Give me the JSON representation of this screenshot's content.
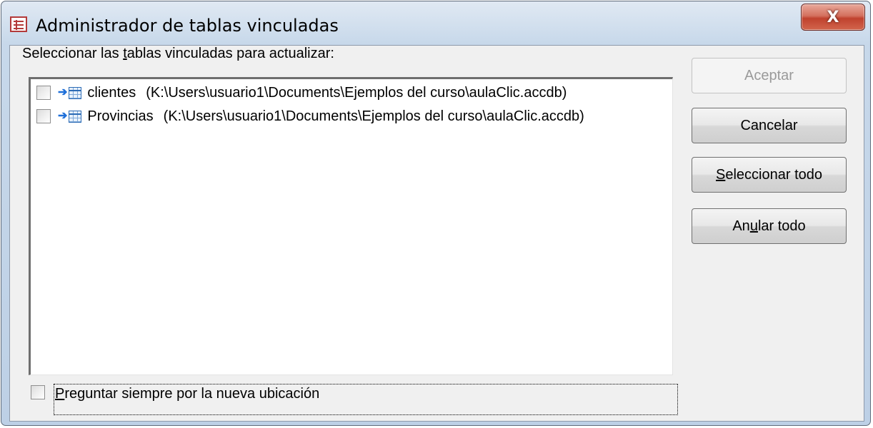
{
  "window": {
    "title": "Administrador de tablas vinculadas",
    "close_symbol": "X",
    "title_icon": "table-form-icon"
  },
  "prompt": {
    "before_access_key": "Seleccionar las ",
    "access_key": "t",
    "after_access_key": "ablas vinculadas para actualizar:"
  },
  "tables": [
    {
      "name": "clientes",
      "path": "(K:\\Users\\usuario1\\Documents\\Ejemplos del curso\\aulaClic.accdb)",
      "checked": false
    },
    {
      "name": "Provincias",
      "path": "(K:\\Users\\usuario1\\Documents\\Ejemplos del curso\\aulaClic.accdb)",
      "checked": false
    }
  ],
  "buttons": {
    "aceptar": "Aceptar",
    "cancelar": "Cancelar",
    "seleccionar_todo": {
      "access_key": "S",
      "rest": "eleccionar todo"
    },
    "anular_todo": {
      "before": "An",
      "access_key": "u",
      "rest": "lar todo"
    }
  },
  "always_ask": {
    "access_key": "P",
    "rest": "reguntar siempre por la nueva ubicación",
    "checked": false
  }
}
